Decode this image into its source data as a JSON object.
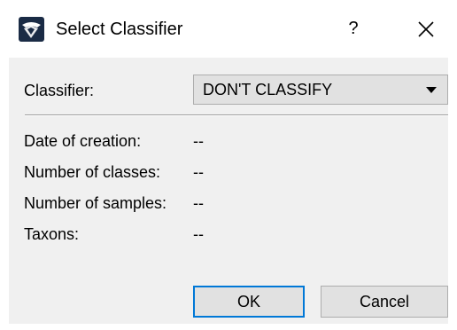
{
  "window": {
    "title": "Select Classifier",
    "help_label": "?",
    "close_icon": "close-icon",
    "app_icon": "app-logo-icon"
  },
  "form": {
    "classifier_label": "Classifier:",
    "classifier_value": "DON'T CLASSIFY",
    "date_label": "Date of creation:",
    "date_value": "--",
    "classes_label": "Number of classes:",
    "classes_value": "--",
    "samples_label": "Number of samples:",
    "samples_value": "--",
    "taxons_label": "Taxons:",
    "taxons_value": "--"
  },
  "buttons": {
    "ok_label": "OK",
    "cancel_label": "Cancel"
  },
  "colors": {
    "client_bg": "#f0f0f0",
    "button_bg": "#e1e1e1",
    "default_button_border": "#0078d7",
    "app_icon_dark": "#1a2b45"
  }
}
